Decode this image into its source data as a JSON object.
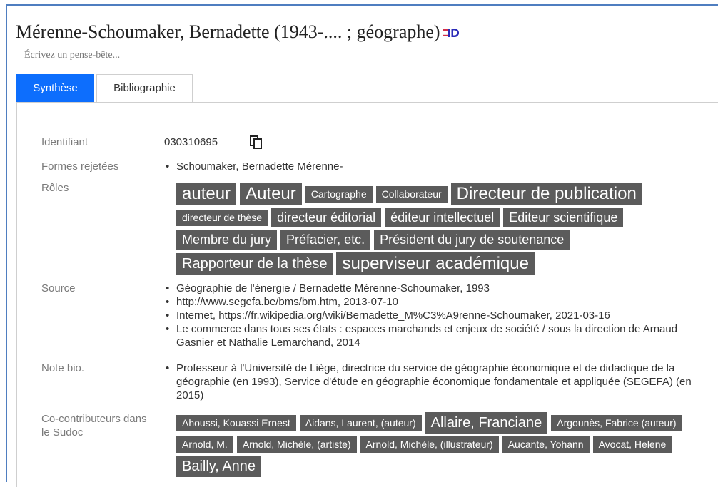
{
  "header": {
    "title": "Mérenne-Schoumaker, Bernadette (1943-.... ; géographe)",
    "id_icon": "id-badge-icon",
    "note_placeholder": "Écrivez un pense-bête..."
  },
  "tabs": [
    {
      "label": "Synthèse",
      "active": true
    },
    {
      "label": "Bibliographie",
      "active": false
    }
  ],
  "fields": {
    "identifiant": {
      "label": "Identifiant",
      "value": "030310695",
      "icon": "copy-icon"
    },
    "formes_rejetees": {
      "label": "Formes rejetées",
      "items": [
        "Schoumaker, Bernadette Mérenne-"
      ]
    },
    "roles": {
      "label": "Rôles",
      "tags": [
        {
          "text": "auteur",
          "size": 4
        },
        {
          "text": "Auteur",
          "size": 4
        },
        {
          "text": "Cartographe",
          "size": 1
        },
        {
          "text": "Collaborateur",
          "size": 1
        },
        {
          "text": "Directeur de publication",
          "size": 4
        },
        {
          "text": "directeur de thèse",
          "size": 1
        },
        {
          "text": "directeur éditorial",
          "size": 2
        },
        {
          "text": "éditeur intellectuel",
          "size": 2
        },
        {
          "text": "Editeur scientifique",
          "size": 2
        },
        {
          "text": "Membre du jury",
          "size": 2
        },
        {
          "text": "Préfacier, etc.",
          "size": 2
        },
        {
          "text": "Président du jury de soutenance",
          "size": 2
        },
        {
          "text": "Rapporteur de la thèse",
          "size": 3
        },
        {
          "text": "superviseur académique",
          "size": 4
        }
      ]
    },
    "source": {
      "label": "Source",
      "items": [
        "Géographie de l'énergie / Bernadette Mérenne-Schoumaker, 1993",
        "http://www.segefa.be/bms/bm.htm, 2013-07-10",
        "Internet, https://fr.wikipedia.org/wiki/Bernadette_M%C3%A9renne-Schoumaker, 2021-03-16",
        "Le commerce dans tous ses états : espaces marchands et enjeux de société / sous la direction de Arnaud Gasnier et Nathalie Lemarchand, 2014"
      ]
    },
    "note_bio": {
      "label": "Note bio.",
      "items": [
        "Professeur à l'Université de Liège, directrice du service de géographie économique et de didactique de la géographie (en 1993), Service d'étude en géographie économique fondamentale et appliquée (SEGEFA) (en 2015)"
      ]
    },
    "co_contributeurs": {
      "label": "Co-contributeurs dans le Sudoc",
      "tags": [
        {
          "text": "Ahoussi, Kouassi Ernest",
          "size": 1
        },
        {
          "text": "Aidans, Laurent, (auteur)",
          "size": 1
        },
        {
          "text": "Allaire, Franciane",
          "size": 3
        },
        {
          "text": "Argounès, Fabrice (auteur)",
          "size": 1
        },
        {
          "text": "Arnold, M.",
          "size": 1
        },
        {
          "text": "Arnold, Michèle, (artiste)",
          "size": 1
        },
        {
          "text": "Arnold, Michèle, (illustrateur)",
          "size": 1
        },
        {
          "text": "Aucante, Yohann",
          "size": 1
        },
        {
          "text": "Avocat, Helene",
          "size": 1
        },
        {
          "text": "Bailly, Anne",
          "size": 3
        }
      ]
    }
  },
  "colors": {
    "accent": "#0d6efd",
    "tag_bg": "#5b5b5b",
    "id_icon": "#d32f4a"
  }
}
